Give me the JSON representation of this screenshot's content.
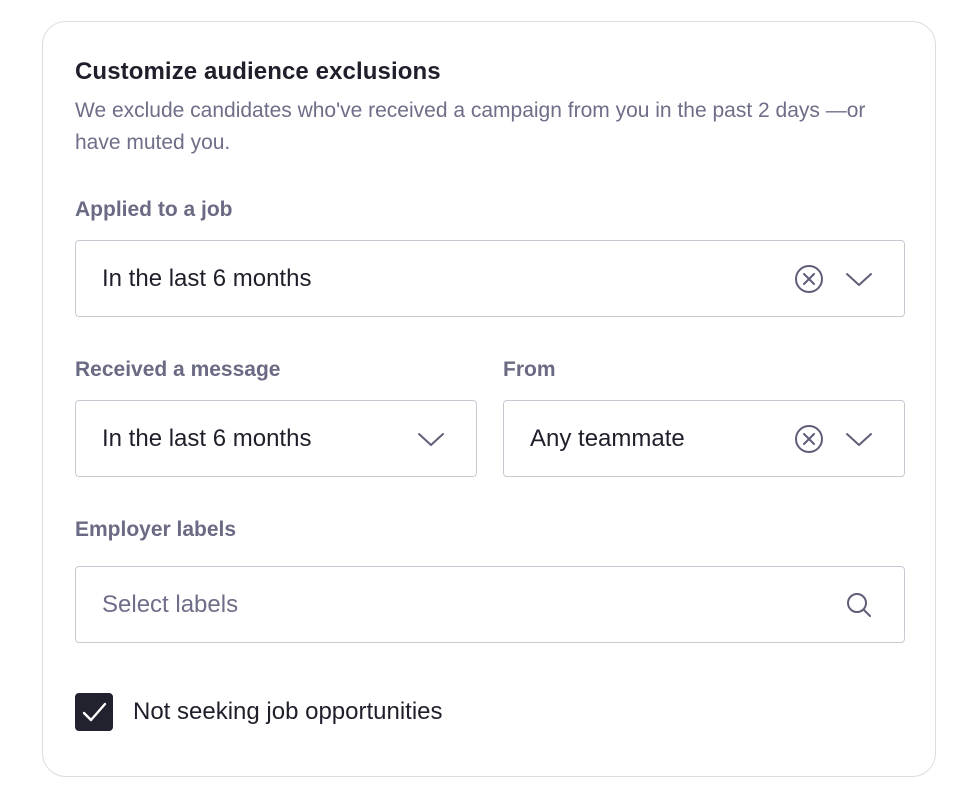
{
  "panel": {
    "title": "Customize audience exclusions",
    "description": "We exclude candidates who've received a campaign from you in the past 2 days —or have muted you."
  },
  "applied_job": {
    "label": "Applied to a job",
    "value": "In the last 6 months",
    "icons": [
      "clear-icon",
      "chevron-down-icon"
    ]
  },
  "received_message": {
    "label": "Received a message",
    "value": "In the last 6 months",
    "icons": [
      "chevron-down-icon"
    ]
  },
  "from": {
    "label": "From",
    "value": "Any teammate",
    "icons": [
      "clear-icon",
      "chevron-down-icon"
    ]
  },
  "employer_labels": {
    "label": "Employer labels",
    "placeholder": "Select labels",
    "icons": [
      "search-icon"
    ]
  },
  "not_seeking": {
    "label": "Not seeking job opportunities",
    "checked": true
  },
  "colors": {
    "text_primary": "#1f1f2b",
    "text_secondary": "#6e6e88",
    "border": "#c9c9d3",
    "checkbox_fill": "#22222e"
  }
}
